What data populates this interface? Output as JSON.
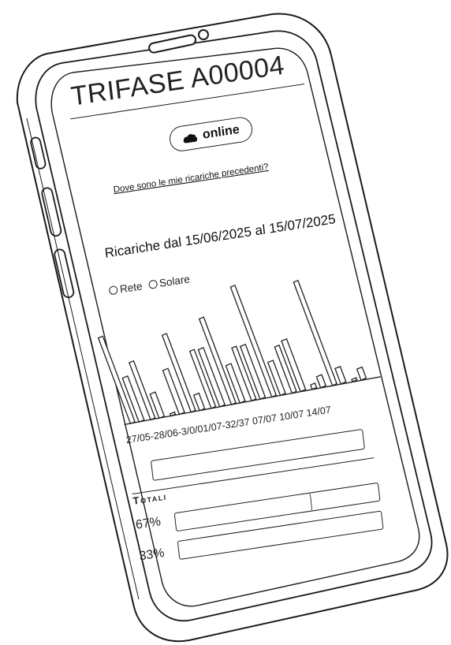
{
  "device": {
    "title": "TRIFASE A00004",
    "status": {
      "label": "online",
      "icon": "cloud-icon"
    },
    "history_link": "Dove sono le mie ricariche precedenti?"
  },
  "period_label": "Ricariche dal 15/06/2025 al 15/07/2025",
  "legend": [
    {
      "label": "Rete",
      "icon": "radio-icon"
    },
    {
      "label": "Solare",
      "icon": "radio-icon"
    }
  ],
  "chart_data": {
    "type": "bar",
    "x_tick_labels": [
      "27/05",
      "28/06",
      "3/07",
      "01/07",
      "32/37",
      "07/07",
      "10/07",
      "14/07"
    ],
    "x_tick_text": "27/05-28/06-3/0/01/07-32/37 07/07 10/07 14/07",
    "series": [
      {
        "name": "Rete",
        "values": [
          78,
          52,
          2,
          70,
          52,
          78,
          48,
          100,
          42,
          4,
          94,
          2
        ]
      },
      {
        "name": "Solare",
        "values": [
          40,
          22,
          40,
          14,
          52,
          34,
          48,
          30,
          46,
          10,
          14,
          10
        ]
      }
    ],
    "ylim": [
      0,
      100
    ],
    "grid": false
  },
  "totals": {
    "label": "Totali",
    "rows": [
      {
        "percent": "67%",
        "fill": 0.67
      },
      {
        "percent": "33%",
        "fill": 0.0
      }
    ]
  },
  "colors": {
    "ink": "#222222",
    "background": "#ffffff"
  }
}
